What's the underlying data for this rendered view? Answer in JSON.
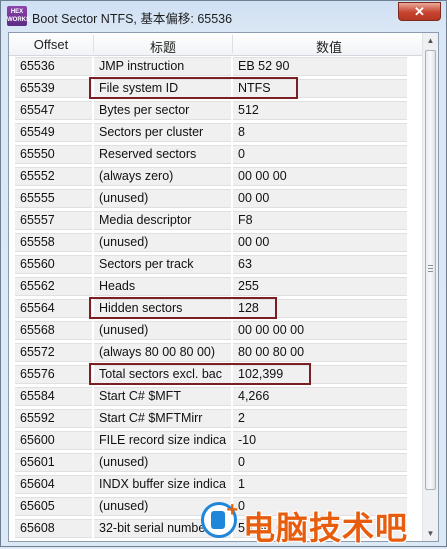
{
  "window": {
    "title": "Boot Sector NTFS, 基本偏移: 65536",
    "app_icon_line1": "HEX",
    "app_icon_line2": "WORKS",
    "close_label": "✕"
  },
  "table": {
    "columns": [
      "Offset",
      "标题",
      "数值"
    ],
    "rows": [
      {
        "offset": "65536",
        "title": "JMP instruction",
        "value": "EB 52 90"
      },
      {
        "offset": "65539",
        "title": "File system ID",
        "value": "NTFS"
      },
      {
        "offset": "65547",
        "title": "Bytes per sector",
        "value": "512"
      },
      {
        "offset": "65549",
        "title": "Sectors per cluster",
        "value": "8"
      },
      {
        "offset": "65550",
        "title": "Reserved sectors",
        "value": "0"
      },
      {
        "offset": "65552",
        "title": "(always zero)",
        "value": "00 00 00"
      },
      {
        "offset": "65555",
        "title": "(unused)",
        "value": "00 00"
      },
      {
        "offset": "65557",
        "title": "Media descriptor",
        "value": "F8"
      },
      {
        "offset": "65558",
        "title": "(unused)",
        "value": "00 00"
      },
      {
        "offset": "65560",
        "title": "Sectors per track",
        "value": "63"
      },
      {
        "offset": "65562",
        "title": "Heads",
        "value": "255"
      },
      {
        "offset": "65564",
        "title": "Hidden sectors",
        "value": "128"
      },
      {
        "offset": "65568",
        "title": "(unused)",
        "value": "00 00 00 00"
      },
      {
        "offset": "65572",
        "title": "(always 80 00 80 00)",
        "value": "80 00 80 00"
      },
      {
        "offset": "65576",
        "title": "Total sectors excl. bac",
        "value": "102,399"
      },
      {
        "offset": "65584",
        "title": "Start C# $MFT",
        "value": "4,266"
      },
      {
        "offset": "65592",
        "title": "Start C# $MFTMirr",
        "value": "2"
      },
      {
        "offset": "65600",
        "title": "FILE record size indica",
        "value": "-10"
      },
      {
        "offset": "65601",
        "title": "(unused)",
        "value": "0"
      },
      {
        "offset": "65604",
        "title": "INDX buffer size indica",
        "value": "1"
      },
      {
        "offset": "65605",
        "title": "(unused)",
        "value": "0"
      },
      {
        "offset": "65608",
        "title": "32-bit serial numbe",
        "value": "50 BC 6 63"
      }
    ]
  },
  "highlight_color": "#7a1f24",
  "watermark": {
    "text": "电脑技术吧"
  }
}
